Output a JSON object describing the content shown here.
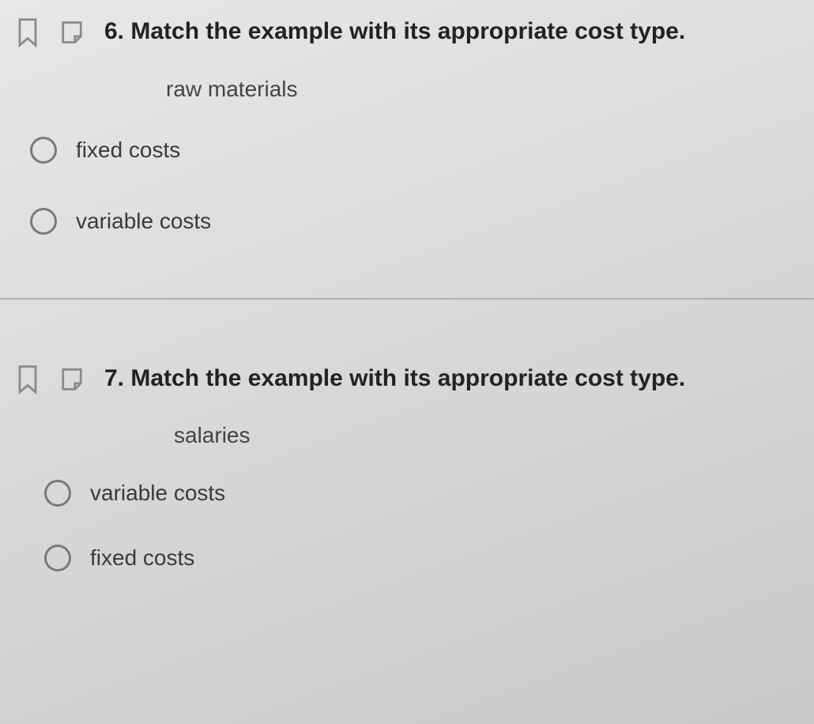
{
  "questions": [
    {
      "number": "6.",
      "prompt": "Match the example with its appropriate cost type.",
      "example": "raw materials",
      "options": [
        {
          "label": "fixed costs"
        },
        {
          "label": "variable costs"
        }
      ]
    },
    {
      "number": "7.",
      "prompt": "Match the example with its appropriate cost type.",
      "example": "salaries",
      "options": [
        {
          "label": "variable costs"
        },
        {
          "label": "fixed costs"
        }
      ]
    }
  ]
}
